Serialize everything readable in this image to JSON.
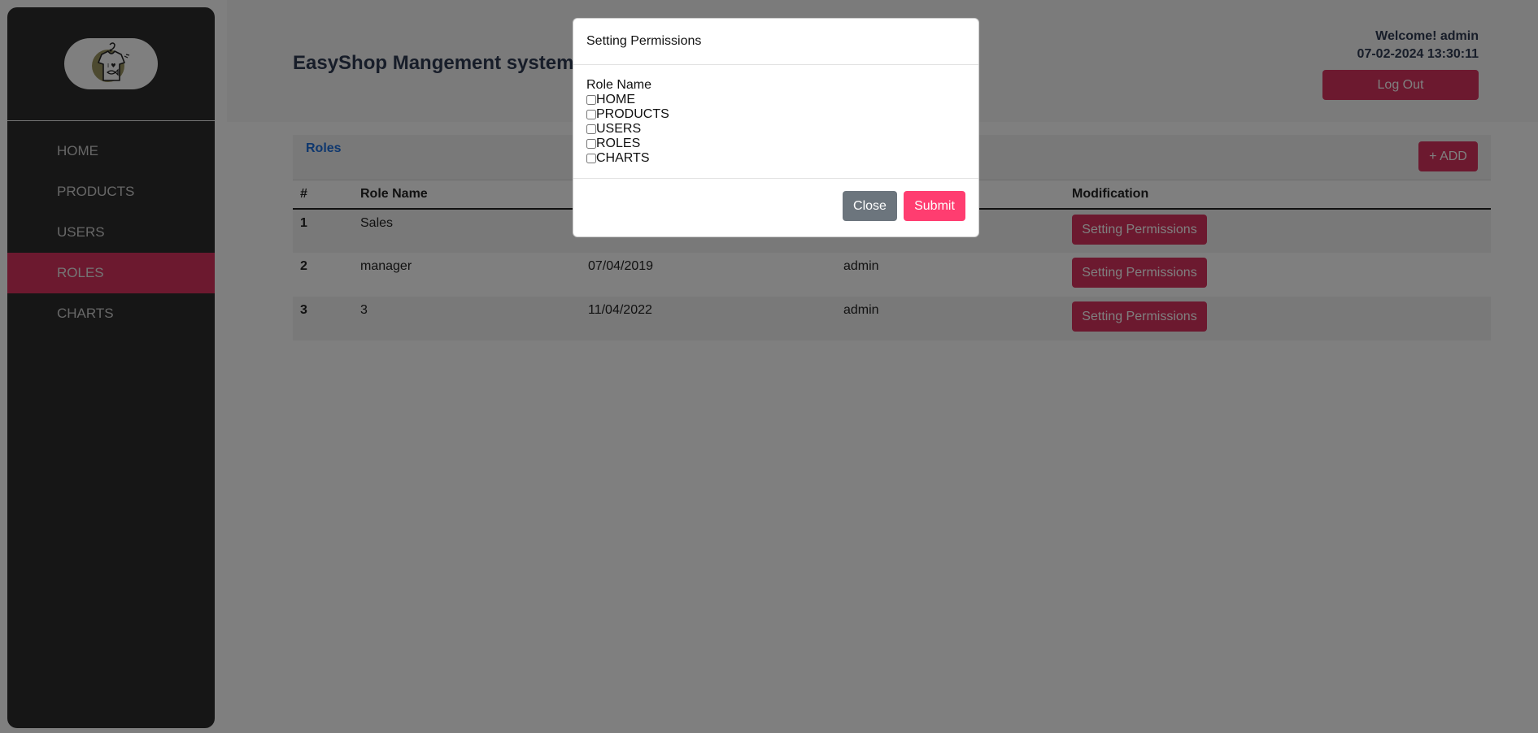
{
  "sidebar": {
    "logo_icon": "tshirt-logo-icon",
    "items": [
      {
        "label": "HOME",
        "active": false
      },
      {
        "label": "PRODUCTS",
        "active": false
      },
      {
        "label": "USERS",
        "active": false
      },
      {
        "label": "ROLES",
        "active": true
      },
      {
        "label": "CHARTS",
        "active": false
      }
    ]
  },
  "header": {
    "title": "EasyShop Mangement system",
    "welcome": "Welcome! admin",
    "datetime": "07-02-2024 13:30:11",
    "logout_label": "Log Out"
  },
  "roles_page": {
    "tab_label": "Roles",
    "add_label": "+ ADD",
    "columns": [
      "#",
      "Role Name",
      "",
      "",
      "Modification"
    ],
    "rows": [
      {
        "idx": "1",
        "role": "Sales",
        "date": "",
        "by": "",
        "action": "Setting Permissions"
      },
      {
        "idx": "2",
        "role": "manager",
        "date": "07/04/2019",
        "by": "admin",
        "action": "Setting Permissions"
      },
      {
        "idx": "3",
        "role": "3",
        "date": "11/04/2022",
        "by": "admin",
        "action": "Setting Permissions"
      }
    ]
  },
  "modal": {
    "title": "Setting Permissions",
    "role_name_label": "Role Name",
    "permissions": [
      {
        "label": "HOME",
        "checked": false
      },
      {
        "label": "PRODUCTS",
        "checked": false
      },
      {
        "label": "USERS",
        "checked": false
      },
      {
        "label": "ROLES",
        "checked": false
      },
      {
        "label": "CHARTS",
        "checked": false
      }
    ],
    "close_label": "Close",
    "submit_label": "Submit"
  },
  "colors": {
    "accent": "#d9335f",
    "sidebar_bg": "#2d2d2d",
    "link": "#1d6fdc",
    "submit": "#ff3d70",
    "close": "#6c757d"
  }
}
